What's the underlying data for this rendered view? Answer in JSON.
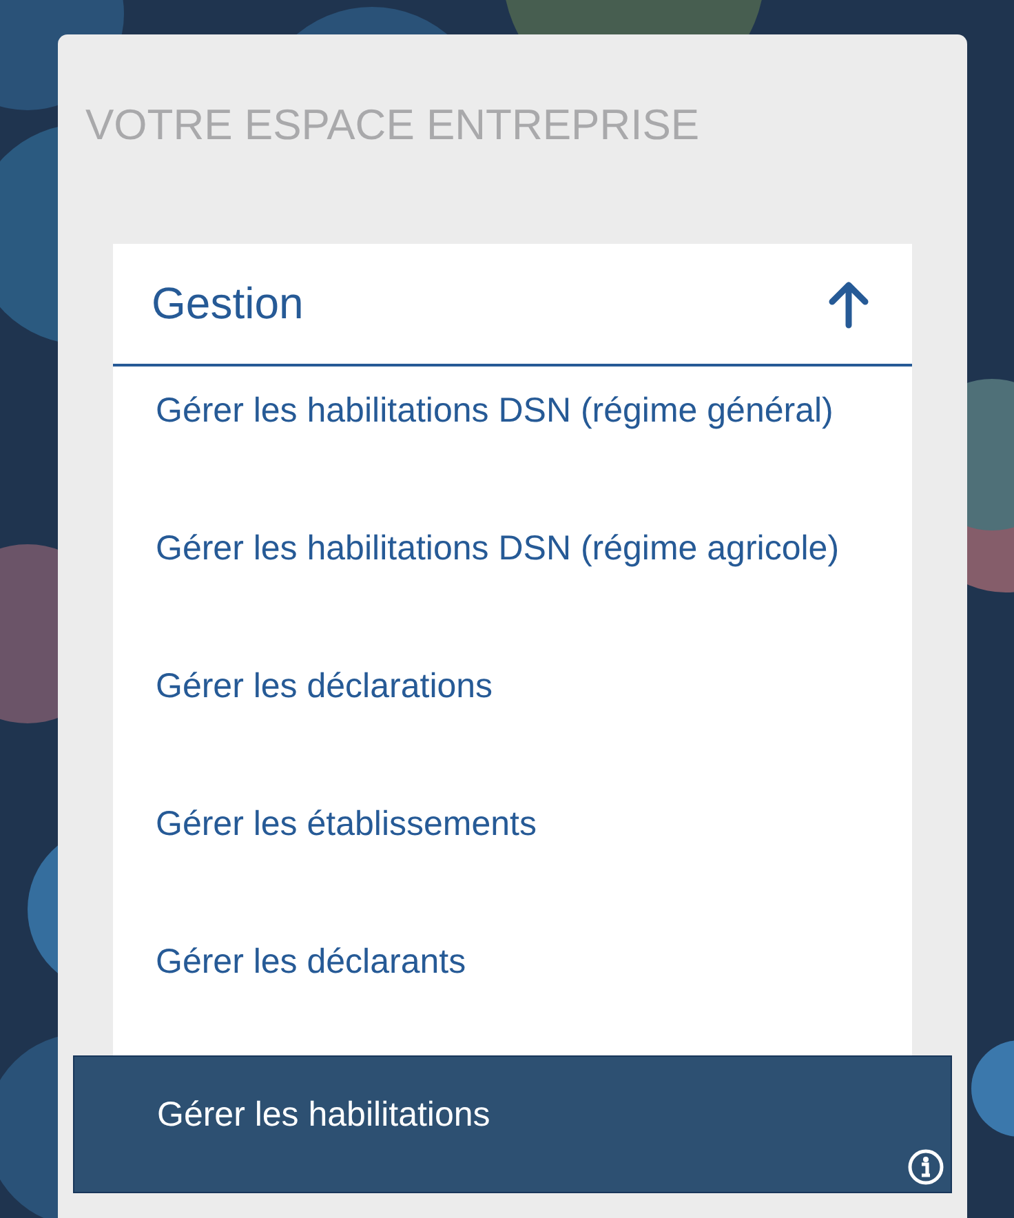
{
  "panel": {
    "title": "VOTRE ESPACE ENTREPRISE"
  },
  "section": {
    "title": "Gestion",
    "expanded": true
  },
  "items": [
    {
      "label": "Gérer les habilitations DSN (régime général)",
      "selected": false
    },
    {
      "label": "Gérer les habilitations DSN (régime agricole)",
      "selected": false
    },
    {
      "label": "Gérer les déclarations",
      "selected": false
    },
    {
      "label": "Gérer les établissements",
      "selected": false
    },
    {
      "label": "Gérer les déclarants",
      "selected": false
    },
    {
      "label": "Gérer les habilitations",
      "selected": true
    }
  ]
}
